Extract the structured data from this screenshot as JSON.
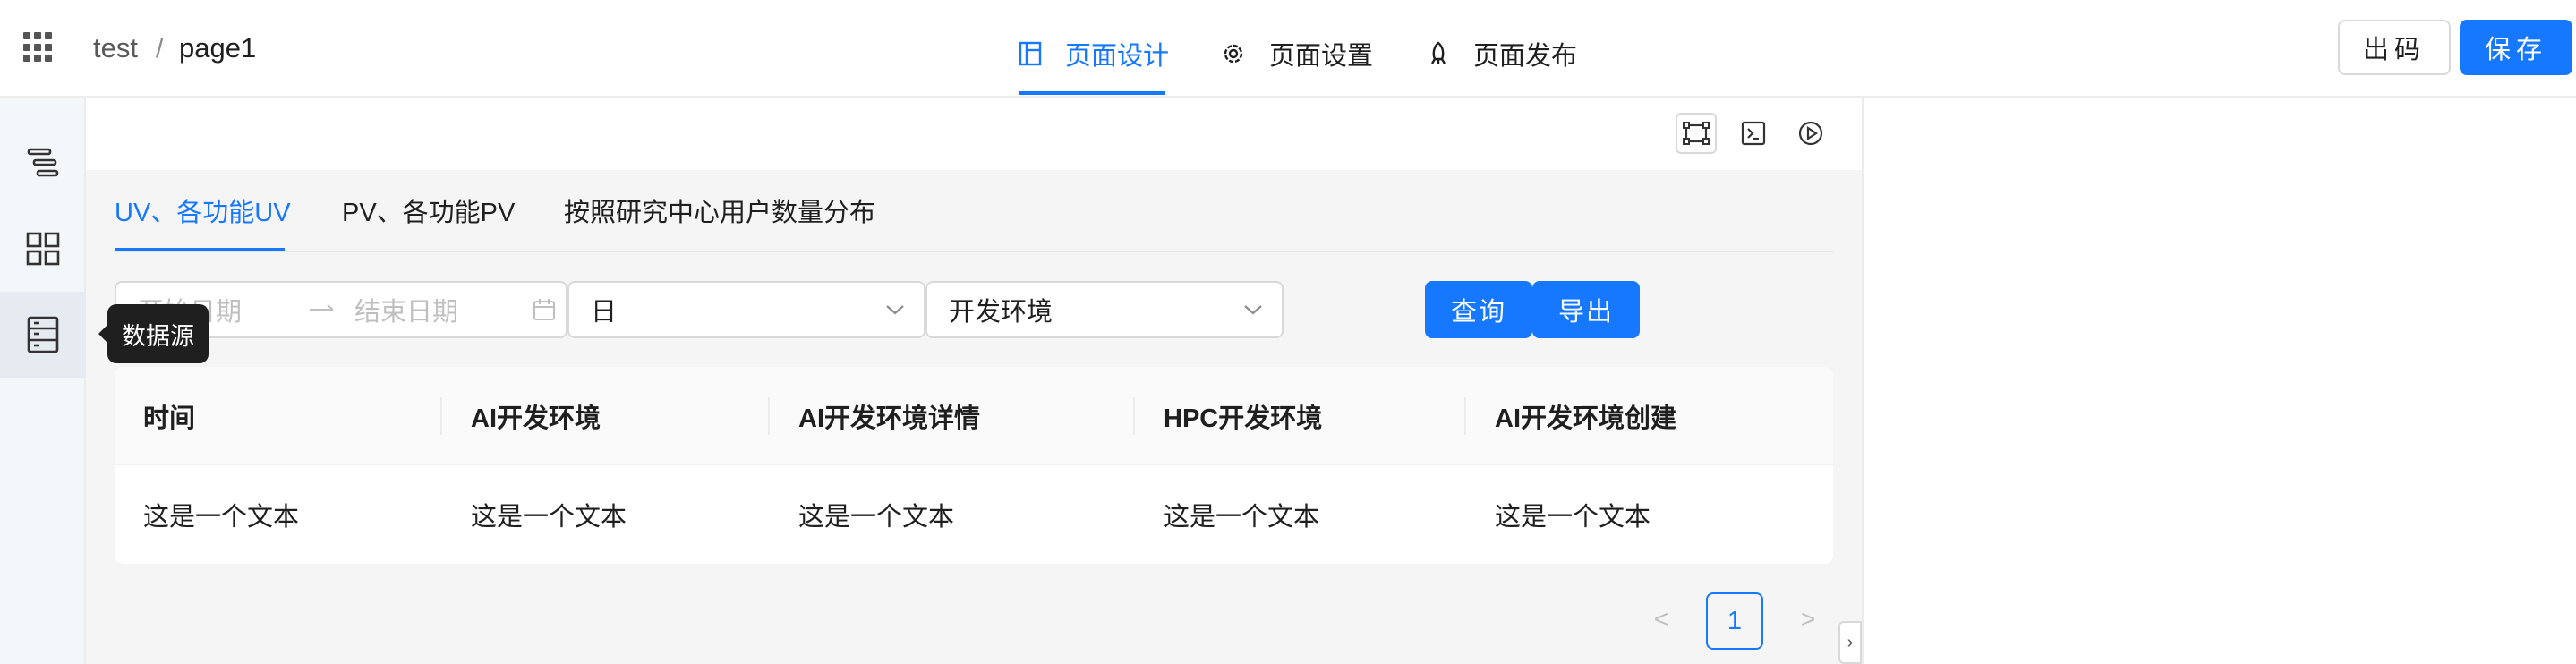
{
  "header": {
    "breadcrumb": [
      "test",
      "/",
      "page1"
    ],
    "tabs": [
      {
        "label": "页面设计",
        "icon": "layout-icon",
        "active": true
      },
      {
        "label": "页面设置",
        "icon": "gear-icon",
        "active": false
      },
      {
        "label": "页面发布",
        "icon": "rocket-icon",
        "active": false
      }
    ],
    "export_code_label": "出码",
    "save_label": "保存"
  },
  "sidebar": {
    "items": [
      {
        "icon": "outline-tree-icon",
        "active": false
      },
      {
        "icon": "components-grid-icon",
        "active": false
      },
      {
        "icon": "datasource-icon",
        "active": true
      }
    ],
    "tooltip": "数据源"
  },
  "toolbar": {
    "icons": [
      "frame-icon",
      "terminal-icon",
      "play-icon"
    ],
    "active": "frame-icon"
  },
  "inner_tabs": [
    {
      "label": "UV、各功能UV",
      "active": true
    },
    {
      "label": "PV、各功能PV",
      "active": false
    },
    {
      "label": "按照研究中心用户数量分布",
      "active": false
    }
  ],
  "filters": {
    "start_date_placeholder": "开始日期",
    "end_date_placeholder": "结束日期",
    "granularity": "日",
    "environment": "开发环境",
    "query_label": "查询",
    "export_label": "导出"
  },
  "table": {
    "columns": [
      "时间",
      "AI开发环境",
      "AI开发环境详情",
      "HPC开发环境",
      "AI开发环境创建"
    ],
    "rows": [
      [
        "这是一个文本",
        "这是一个文本",
        "这是一个文本",
        "这是一个文本",
        "这是一个文本"
      ]
    ]
  },
  "pagination": {
    "current_page": "1",
    "prev": "<",
    "next": ">"
  },
  "colors": {
    "primary": "#1677ff",
    "tooltip_bg": "#1f1f1f",
    "canvas_bg": "#f5f5f5"
  }
}
